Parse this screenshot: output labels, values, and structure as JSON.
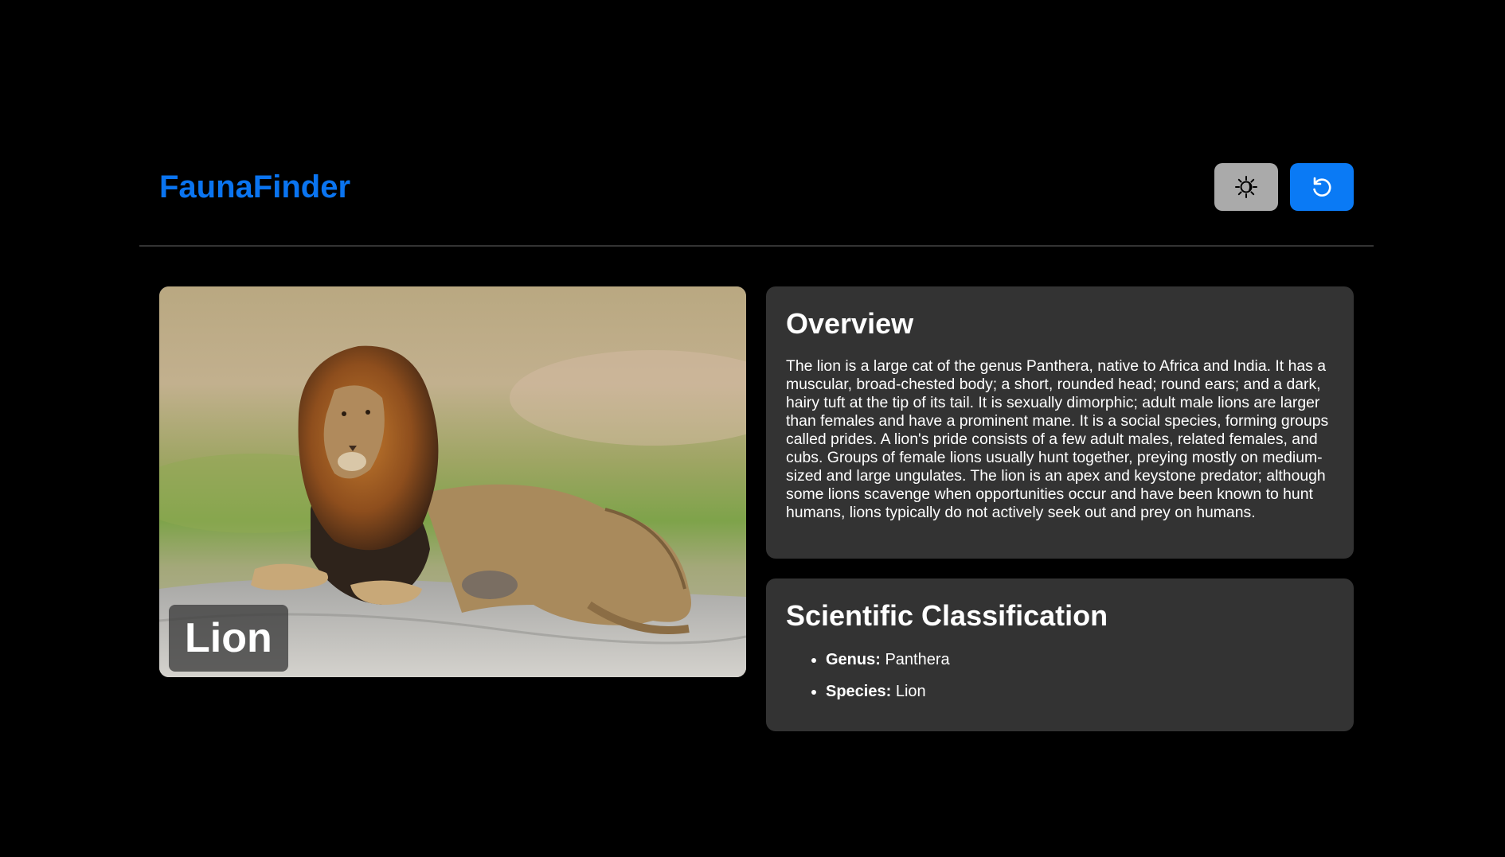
{
  "header": {
    "brand": "FaunaFinder",
    "theme_button_icon": "sun-moon-icon",
    "refresh_button_icon": "refresh-icon"
  },
  "colors": {
    "accent": "#0a74f0",
    "card_bg": "#333333",
    "theme_button_bg": "#aaaaaa"
  },
  "hero": {
    "animal_name": "Lion"
  },
  "overview": {
    "title": "Overview",
    "text": "The lion is a large cat of the genus Panthera, native to Africa and India. It has a muscular, broad-chested body; a short, rounded head; round ears; and a dark, hairy tuft at the tip of its tail. It is sexually dimorphic; adult male lions are larger than females and have a prominent mane. It is a social species, forming groups called prides. A lion's pride consists of a few adult males, related females, and cubs. Groups of female lions usually hunt together, preying mostly on medium-sized and large ungulates. The lion is an apex and keystone predator; although some lions scavenge when opportunities occur and have been known to hunt humans, lions typically do not actively seek out and prey on humans."
  },
  "classification": {
    "title": "Scientific Classification",
    "items": [
      {
        "label": "Genus:",
        "value": "Panthera"
      },
      {
        "label": "Species:",
        "value": "Lion"
      }
    ]
  }
}
